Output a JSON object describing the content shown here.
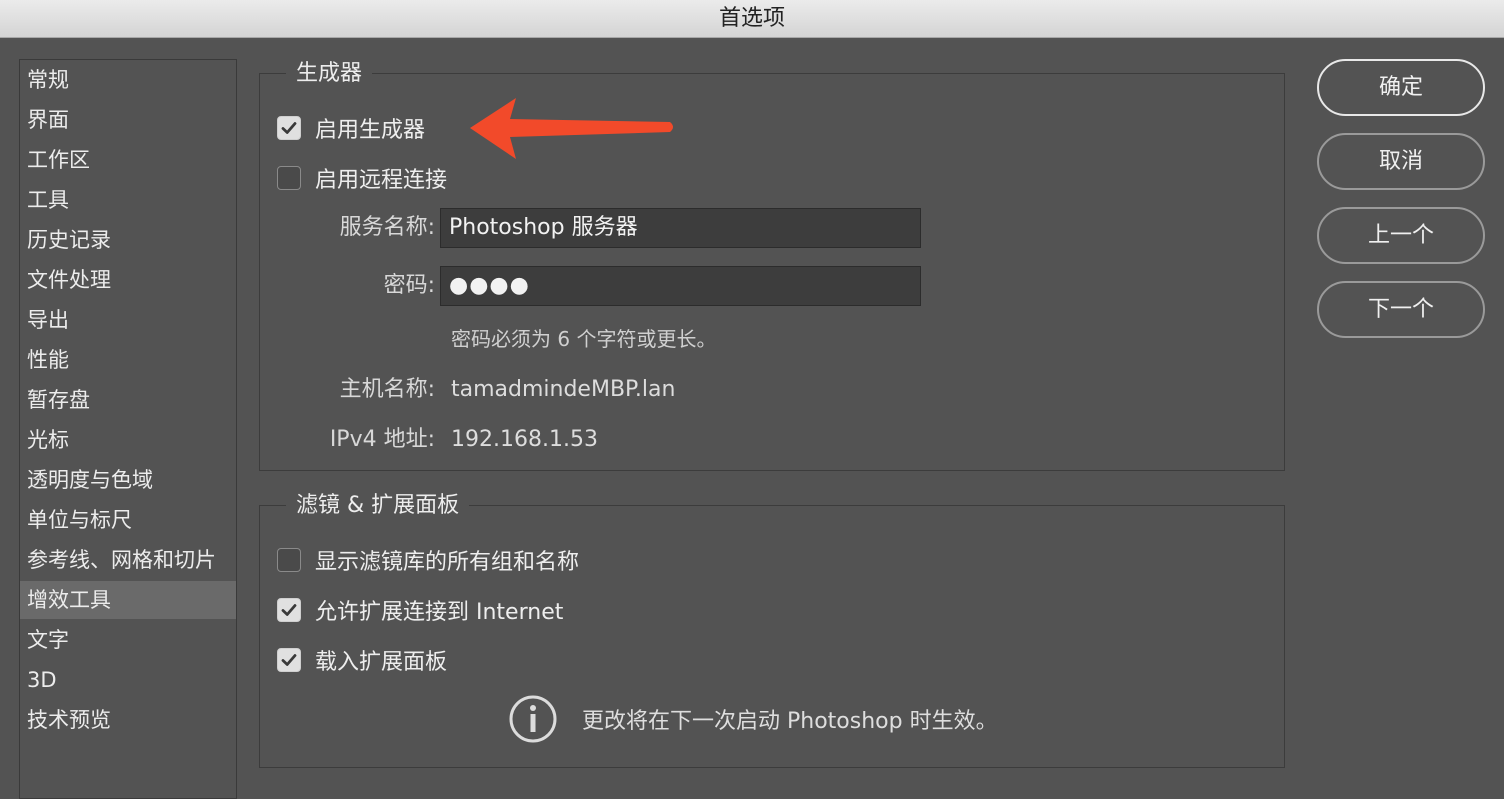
{
  "window": {
    "title": "首选项"
  },
  "sidebar": {
    "items": [
      {
        "label": "常规"
      },
      {
        "label": "界面"
      },
      {
        "label": "工作区"
      },
      {
        "label": "工具"
      },
      {
        "label": "历史记录"
      },
      {
        "label": "文件处理"
      },
      {
        "label": "导出"
      },
      {
        "label": "性能"
      },
      {
        "label": "暂存盘"
      },
      {
        "label": "光标"
      },
      {
        "label": "透明度与色域"
      },
      {
        "label": "单位与标尺"
      },
      {
        "label": "参考线、网格和切片"
      },
      {
        "label": "增效工具",
        "selected": true
      },
      {
        "label": "文字"
      },
      {
        "label": "3D"
      },
      {
        "label": "技术预览"
      }
    ]
  },
  "generator": {
    "title": "生成器",
    "enable_generator": {
      "label": "启用生成器",
      "checked": true
    },
    "enable_remote": {
      "label": "启用远程连接",
      "checked": false
    },
    "service_name": {
      "label": "服务名称:",
      "value": "Photoshop 服务器"
    },
    "password": {
      "label": "密码:",
      "value": "●●●●"
    },
    "password_hint": "密码必须为 6 个字符或更长。",
    "hostname": {
      "label": "主机名称:",
      "value": "tamadmindeMBP.lan"
    },
    "ipv4": {
      "label": "IPv4 地址:",
      "value": "192.168.1.53"
    }
  },
  "filters": {
    "title": "滤镜 & 扩展面板",
    "show_all_groups": {
      "label": "显示滤镜库的所有组和名称",
      "checked": false
    },
    "allow_extensions_internet": {
      "label": "允许扩展连接到 Internet",
      "checked": true
    },
    "load_extension_panels": {
      "label": "载入扩展面板",
      "checked": true
    },
    "info_message": "更改将在下一次启动 Photoshop 时生效。"
  },
  "buttons": {
    "ok": "确定",
    "cancel": "取消",
    "prev": "上一个",
    "next": "下一个"
  },
  "colors": {
    "annotation_arrow": "#f24a2a",
    "selected_item": "#6a6a6a"
  }
}
